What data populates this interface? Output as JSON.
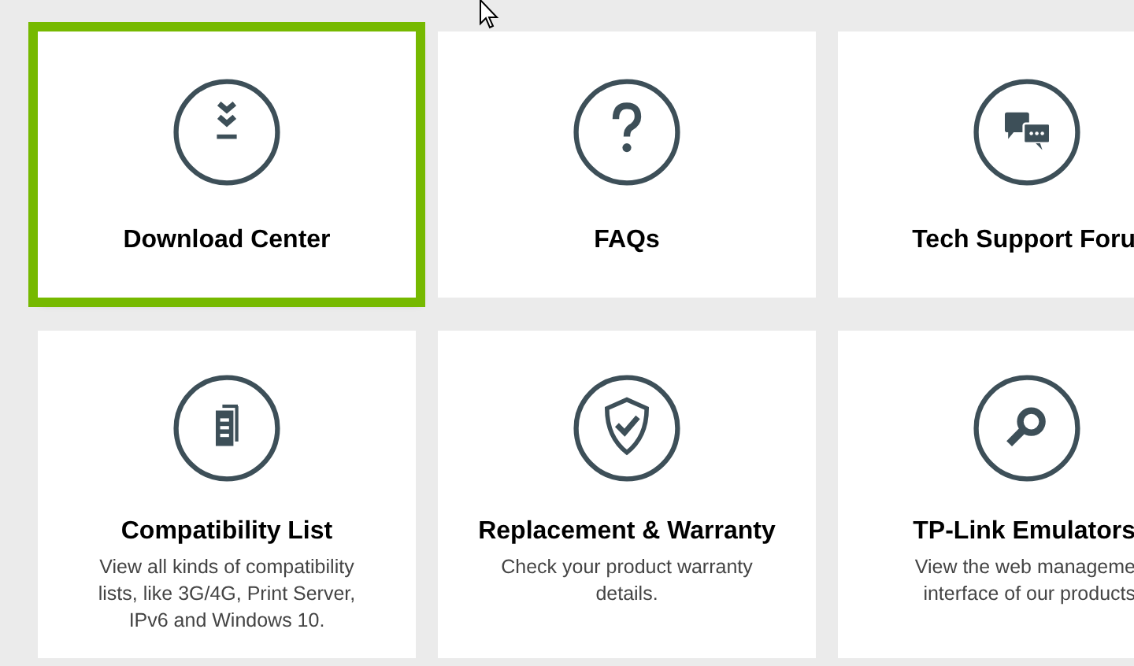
{
  "cards": [
    {
      "kind": "download",
      "title": "Download Center",
      "selected": true
    },
    {
      "kind": "faq",
      "title": "FAQs",
      "selected": false
    },
    {
      "kind": "forum",
      "title": "Tech Support Foru",
      "selected": false
    },
    {
      "kind": "list",
      "title": "Compatibility List",
      "description": "View all kinds of compatibility lists, like 3G/4G, Print Server, IPv6 and Windows 10.",
      "selected": false
    },
    {
      "kind": "warranty",
      "title": "Replacement & Warranty",
      "description": "Check your product warranty details.",
      "selected": false
    },
    {
      "kind": "emulator",
      "title": "TP-Link Emulators",
      "description_lines": [
        "View the web manageme",
        "interface of our products"
      ],
      "selected": false
    }
  ]
}
